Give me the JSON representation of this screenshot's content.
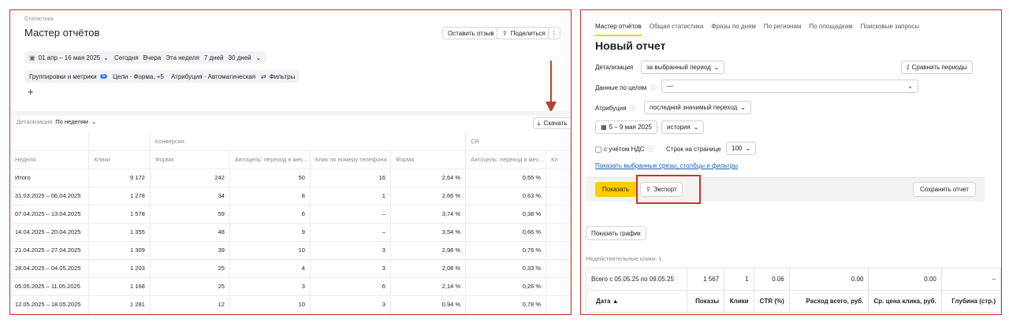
{
  "left": {
    "breadcrumb": "Статистика",
    "title": "Мастер отчётов",
    "feedback_btn": "Оставить отзыв",
    "share_btn": "Поделиться",
    "more_icon": "more-vertical-icon",
    "date_range": "01 апр – 16 мая 2025",
    "quick_ranges": [
      "Сегодня",
      "Вчера",
      "Эта неделя",
      "7 дней",
      "30 дней"
    ],
    "groupings": "Группировки и метрики",
    "groupings_badge": "5",
    "goals": "Цели · Форма, +5",
    "attribution": "Атрибуция · Автоматическая",
    "filters": "Фильтры",
    "add_plus": "+",
    "detail_label": "Детализация",
    "detail_value": "По неделям",
    "download": "Скачать",
    "group_headers": {
      "conv": "Конверсии",
      "cr": "CR"
    },
    "columns": [
      "Неделя",
      "Клики",
      "Форма",
      "Автоцель: переход в мес...",
      "Клик по номеру телефона",
      "Форма",
      "Автоцель: переход в мес...",
      "Кл"
    ],
    "rows": [
      [
        "Итого",
        "9 172",
        "242",
        "50",
        "16",
        "2,64 %",
        "0,55 %"
      ],
      [
        "31.03.2025 – 06.04.2025",
        "1 278",
        "34",
        "8",
        "1",
        "2,66 %",
        "0,63 %"
      ],
      [
        "07.04.2025 – 13.04.2025",
        "1 578",
        "59",
        "6",
        "–",
        "3,74 %",
        "0,38 %"
      ],
      [
        "14.04.2025 – 20.04.2025",
        "1 355",
        "48",
        "9",
        "–",
        "3,54 %",
        "0,66 %"
      ],
      [
        "21.04.2025 – 27.04.2025",
        "1 309",
        "39",
        "10",
        "3",
        "2,98 %",
        "0,76 %"
      ],
      [
        "28.04.2025 – 04.05.2025",
        "1 203",
        "25",
        "4",
        "3",
        "2,08 %",
        "0,33 %"
      ],
      [
        "05.05.2025 – 11.05.2025",
        "1 168",
        "25",
        "3",
        "6",
        "2,14 %",
        "0,26 %"
      ],
      [
        "12.05.2025 – 18.05.2025",
        "1 281",
        "12",
        "10",
        "3",
        "0,94 %",
        "0,78 %"
      ]
    ]
  },
  "right": {
    "tabs": [
      "Мастер отчётов",
      "Общая статистика",
      "Фразы по дням",
      "По регионам",
      "По площадкам",
      "Поисковые запросы"
    ],
    "title": "Новый отчет",
    "detail_label": "Детализация",
    "detail_value": "за выбранный период",
    "compare_btn": "Сравнить периоды",
    "goals_label": "Данные по целям",
    "goals_value": "—",
    "attr_label": "Атрибуция",
    "attr_value": "последний значимый переход",
    "date_value": "5 – 9 мая 2025",
    "history_value": "история",
    "vat_label": "с учётом НДС",
    "rows_label": "Строк на странице",
    "rows_value": "100",
    "show_link": "Показать выбранные срезы, столбцы и фильтры",
    "show_btn": "Показать",
    "export_btn": "Экспорт",
    "save_btn": "Сохранить отчет",
    "chart_btn": "Показать график",
    "invalid_clicks": "Недействительные клики: 1.",
    "total_row": [
      "Всего с 05.05.25 по 09.05.25",
      "1 567",
      "1",
      "0.06",
      "0.00",
      "0.00",
      "–"
    ],
    "headers": [
      "Дата ▲",
      "Показы",
      "Клики",
      "CTR (%)",
      "Расход всего, руб.",
      "Ср. цена клика, руб.",
      "Глубина (стр.)"
    ]
  },
  "colors": {
    "accent": "#ffcc00",
    "highlight_border": "#c9302c",
    "arrow": "#b5452c",
    "badge": "#3e7cf5"
  }
}
